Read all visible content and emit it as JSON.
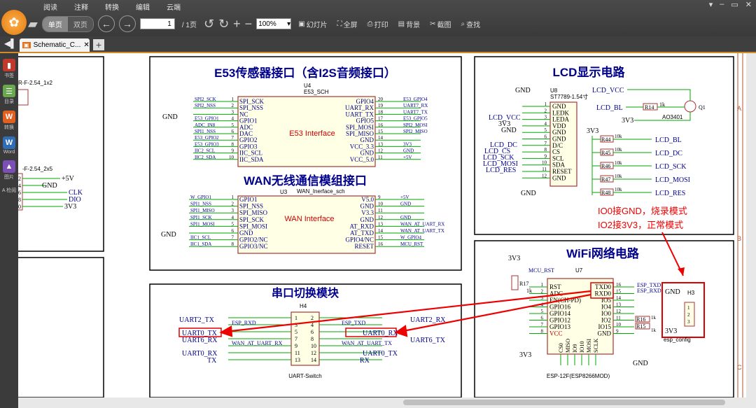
{
  "menu": {
    "tabs": [
      "阅读",
      "注释",
      "转换",
      "编辑",
      "云端"
    ],
    "window_controls": [
      "▾",
      "–",
      "▭",
      "✕"
    ]
  },
  "toolbar": {
    "single_page": "单页",
    "double_page": "双页",
    "page_value": "1",
    "page_total": "/ 1页",
    "zoom": "100%",
    "slideshow": "幻灯片",
    "fullscreen": "全屏",
    "print": "打印",
    "background": "背景",
    "screenshot": "截图",
    "search": "查找"
  },
  "tab": {
    "title": "Schematic_C..."
  },
  "sidebar": [
    {
      "icon": "book-icon",
      "label": "书签"
    },
    {
      "icon": "list-icon",
      "label": "目录"
    },
    {
      "icon": "convert-icon",
      "label": "转换"
    },
    {
      "icon": "word-icon",
      "label": "Word"
    },
    {
      "icon": "image-icon",
      "label": "图片"
    },
    {
      "icon": "tools-icon",
      "label": "A 检阅"
    }
  ],
  "schematic": {
    "left_fragment": {
      "conn1": "R-F-2.54_1x2",
      "conn2": "-F-2.54_2x5",
      "pin_labels": [
        "+5V",
        "GND",
        "CLK",
        "DIO",
        "3V3"
      ],
      "pin_nums": [
        "2",
        "4",
        "6",
        "8",
        "0"
      ]
    },
    "e53": {
      "title": "E53传感器接口（含I2S音频接口）",
      "ref": "U4",
      "part": "E53_SCH",
      "body_label": "E53 Interface",
      "left_nets": [
        "SPI2_SCK",
        "SPI2_NSS",
        "",
        "E53_GPIO1",
        "ADC_IN8",
        "SPI1_NSS",
        "E53_GPIO2",
        "E53_GPIO3",
        "IIC2_SCL",
        "IIC2_SDA"
      ],
      "left_pins": [
        "SPI_SCK",
        "SPI_NSS",
        "NC",
        "GPIO1",
        "ADC",
        "DAC",
        "GPIO2",
        "GPIO3",
        "IIC_SCL",
        "IIC_SDA"
      ],
      "right_pins": [
        "GPIO4",
        "UART_RX",
        "UART_TX",
        "GPIO5",
        "SPI_MOSI",
        "SPI_MISO",
        "GND",
        "VCC_3.3",
        "GND",
        "VCC_5.0"
      ],
      "right_nets": [
        "E53_GPIO4",
        "UART7_RX",
        "UART7_TX",
        "E53_GPIO5",
        "SPI2_MOSI",
        "SPI2_MISO",
        "",
        "3V3",
        "GND",
        "+5V"
      ],
      "gnd_left": "GND"
    },
    "wan": {
      "title": "WAN无线通信模组接口",
      "ref": "U3",
      "part": "WAN_Inerface_sch",
      "body_label": "WAN Interface",
      "left_nets": [
        "W_GPIO1",
        "SPI1_NSS",
        "SPI1_MISO",
        "SPI1_SCK",
        "SPI1_MOSI",
        "",
        "IIC1_SCL",
        "IIC1_SDA"
      ],
      "left_pins": [
        "GPIO1",
        "SPI_NSS",
        "SPI_MISO",
        "SPI_SCK",
        "SPI_MOSI",
        "GND",
        "GPIO2/NC",
        "GPIO3/NC"
      ],
      "right_pins": [
        "V5.0",
        "GND",
        "V3.3",
        "GND",
        "AT_RXD",
        "AT_TXD",
        "GPIO4/NC",
        "RESET"
      ],
      "right_nets": [
        "+5V",
        "GND",
        "",
        "GND",
        "WAN_AT_UART_RX",
        "WAN_AT_UART_TX",
        "W_GPIO4",
        "MCU_RST"
      ],
      "gnd_left": "GND"
    },
    "uart": {
      "title": "串口切换模块",
      "ref": "H4",
      "part": "UART-Switch",
      "left_labels": [
        "UART2_TX",
        "UART0_TX",
        "UART6_RX",
        "UART0_RX",
        "TX"
      ],
      "inner_left": [
        "ESP_RXD",
        "WAN_AT_UART_RX"
      ],
      "right_labels": [
        "UART2_RX",
        "UART0_RX",
        "UART6_TX",
        "UART0_TX",
        "RX"
      ],
      "inner_right": [
        "ESP_TXD",
        "WAN_AT_UART_TX"
      ]
    },
    "lcd": {
      "title": "LCD显示电路",
      "ref": "U8",
      "part": "ST7789-1.54寸",
      "pins": [
        "GND",
        "LEDK",
        "LEDA",
        "VDD",
        "GND",
        "GND",
        "D/C",
        "CS",
        "SCL",
        "SDA",
        "RESET",
        "GND"
      ],
      "left_nets": [
        "GND",
        "LCD_VCC",
        "3V3",
        "GND",
        "LCD_DC",
        "LCD_CS",
        "LCD_SCK",
        "LCD_MOSI",
        "LCD_RES",
        "GND"
      ],
      "lcd_vcc": "LCD_VCC",
      "lcd_bl": "LCD_BL",
      "r14": "R14",
      "r14_val": "1k",
      "q_name": "AO3401",
      "q_ref": "Q1",
      "v33": "3V3",
      "res": [
        {
          "ref": "R44",
          "val": "10k",
          "net": "LCD_BL"
        },
        {
          "ref": "R45",
          "val": "10k",
          "net": "LCD_DC"
        },
        {
          "ref": "R46",
          "val": "10k",
          "net": "LCD_SCK"
        },
        {
          "ref": "R47",
          "val": "10k",
          "net": "LCD_MOSI"
        },
        {
          "ref": "R48",
          "val": "10k",
          "net": "LCD_RES"
        }
      ]
    },
    "annotation": {
      "line1": "IO0接GND，烧录模式",
      "line2": "IO2接3V3，正常模式"
    },
    "wifi": {
      "title": "WiFi网络电路",
      "ref": "U7",
      "part": "ESP-12F(ESP8266MOD)",
      "v33": "3V3",
      "mcu_rst": "MCU_RST",
      "r17": "R17",
      "r17_val": "1k",
      "left_pins": [
        "RST",
        "ADC",
        "EN(CH-PD)",
        "GPIO16",
        "GPIO14",
        "GPIO12",
        "GPIO13",
        "VCC"
      ],
      "right_pins": [
        "TXD0",
        "RXD0",
        "IO5",
        "IO4",
        "IO0",
        "IO2",
        "IO15",
        "GND"
      ],
      "bottom_pins": [
        "CS0",
        "MISO",
        "IO9",
        "IO10",
        "MOSI",
        "SCLK"
      ],
      "esp_txd": "ESP_TXD",
      "esp_rxd": "ESP_RXD",
      "r16": "R16",
      "r15": "R15",
      "r_val": "1k",
      "gnd": "GND",
      "h3_ref": "H3",
      "h3_part": "esp_config",
      "h3_gnd": "GND",
      "h3_v33": "3V3"
    },
    "frame_labels": [
      "A",
      "B",
      "C"
    ]
  }
}
